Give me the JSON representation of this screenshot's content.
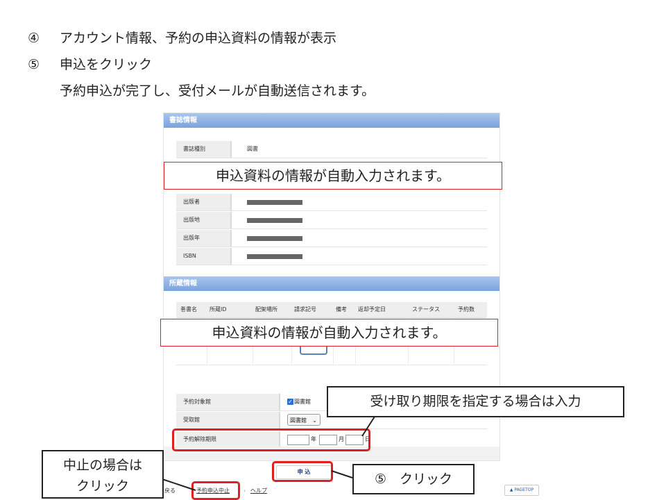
{
  "steps": [
    {
      "num": "④",
      "text": "アカウント情報、予約の申込資料の情報が表示"
    },
    {
      "num": "⑤",
      "text": "申込をクリック"
    },
    {
      "num": "",
      "text": "予約申込が完了し、受付メールが自動送信されます。"
    }
  ],
  "biblio": {
    "header": "書誌情報",
    "rows": [
      {
        "label": "書誌種別",
        "value": "図書"
      },
      {
        "label": "出版者",
        "value": ""
      },
      {
        "label": "出版地",
        "value": ""
      },
      {
        "label": "出版年",
        "value": ""
      },
      {
        "label": "ISBN",
        "value": ""
      }
    ]
  },
  "holdings": {
    "header": "所蔵情報",
    "columns": [
      "巻書名",
      "所蔵ID",
      "配架場所",
      "請求記号",
      "備考",
      "返却予定日",
      "ステータス",
      "予約数"
    ]
  },
  "reservation": {
    "target_label": "予約対象館",
    "target_value": "図書館",
    "pickup_label": "受取館",
    "pickup_value": "図書館",
    "cancel_label": "予約解除期限",
    "year_unit": "年",
    "month_unit": "月",
    "day_unit": "日"
  },
  "submit_label": "申 込",
  "footer": {
    "back_label": "戻る",
    "cancel_link": "予約申込中止",
    "help_link": "ヘルプ",
    "pagetop": "▲ PAGETOP"
  },
  "annotations": {
    "autofill_1": "申込資料の情報が自動入力されます。",
    "autofill_2": "申込資料の情報が自動入力されます。",
    "deadline_note": "受け取り期限を指定する場合は入力",
    "cancel_note_line1": "中止の場合は",
    "cancel_note_line2": "クリック",
    "click_note": "⑤　クリック"
  },
  "colors": {
    "accent_red": "#e02020",
    "header_blue": "#7aa2dc"
  }
}
